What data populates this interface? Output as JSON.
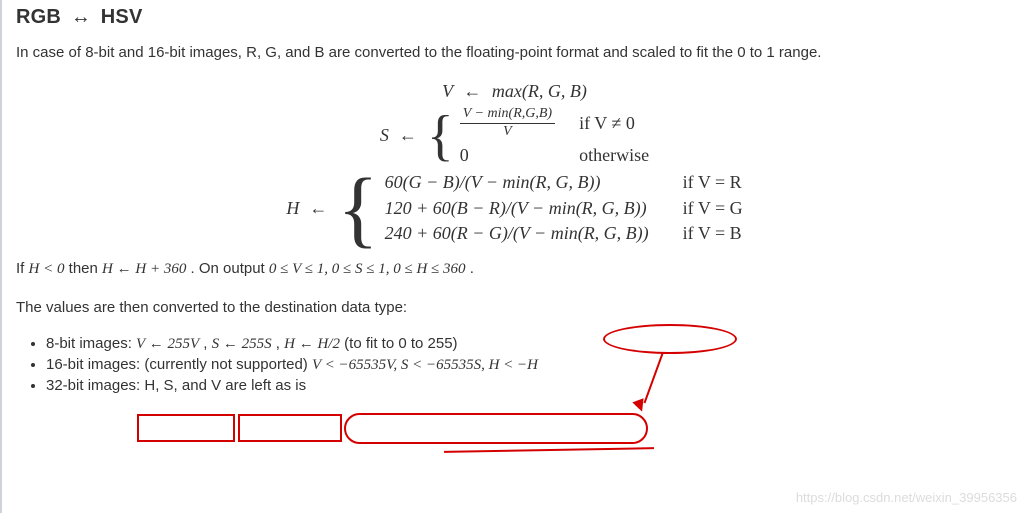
{
  "heading": {
    "lhs": "RGB",
    "rhs": "HSV",
    "arrow": "↔"
  },
  "intro": "In case of 8-bit and 16-bit images, R, G, and B are converted to the floating-point format and scaled to fit the 0 to 1 range.",
  "eq_v": {
    "lhs": "V",
    "assign": "←",
    "rhs": "max(R, G, B)"
  },
  "eq_s": {
    "lhs": "S",
    "assign": "←",
    "c1_num": "V − min(R,G,B)",
    "c1_den": "V",
    "c1_cond": "if V ≠ 0",
    "c2": "0",
    "c2_cond": "otherwise"
  },
  "eq_h": {
    "lhs": "H",
    "assign": "←",
    "r1": "60(G − B)/(V − min(R, G, B))",
    "r1_cond": "if V = R",
    "r2": "120 + 60(B − R)/(V − min(R, G, B))",
    "r2_cond": "if V = G",
    "r3": "240 + 60(R − G)/(V − min(R, G, B))",
    "r3_cond": "if V = B"
  },
  "wrap": {
    "t1": "If ",
    "m1": "H < 0",
    "t2": " then ",
    "m2": "H ← H + 360",
    "t3": " . On output ",
    "m3": "0 ≤ V ≤ 1, 0 ≤ S ≤ 1, ",
    "m4": "0 ≤ H ≤ 360",
    "t4": " ."
  },
  "conv_intro": "The values are then converted to the destination data type:",
  "b8": {
    "label": "8-bit images: ",
    "m1": "V ← 255V",
    "comma": ", ",
    "m2": "S ← 255S",
    "comma2": ", ",
    "m3": "H ← H/2",
    "tail": "(to fit to 0 to 255)"
  },
  "b16": {
    "label": "16-bit images: (currently not supported) ",
    "m": "V < −65535V, S < −65535S, H < −H"
  },
  "b32": "32-bit images: H, S, and V are left as is",
  "watermark": "https://blog.csdn.net/weixin_39956356"
}
